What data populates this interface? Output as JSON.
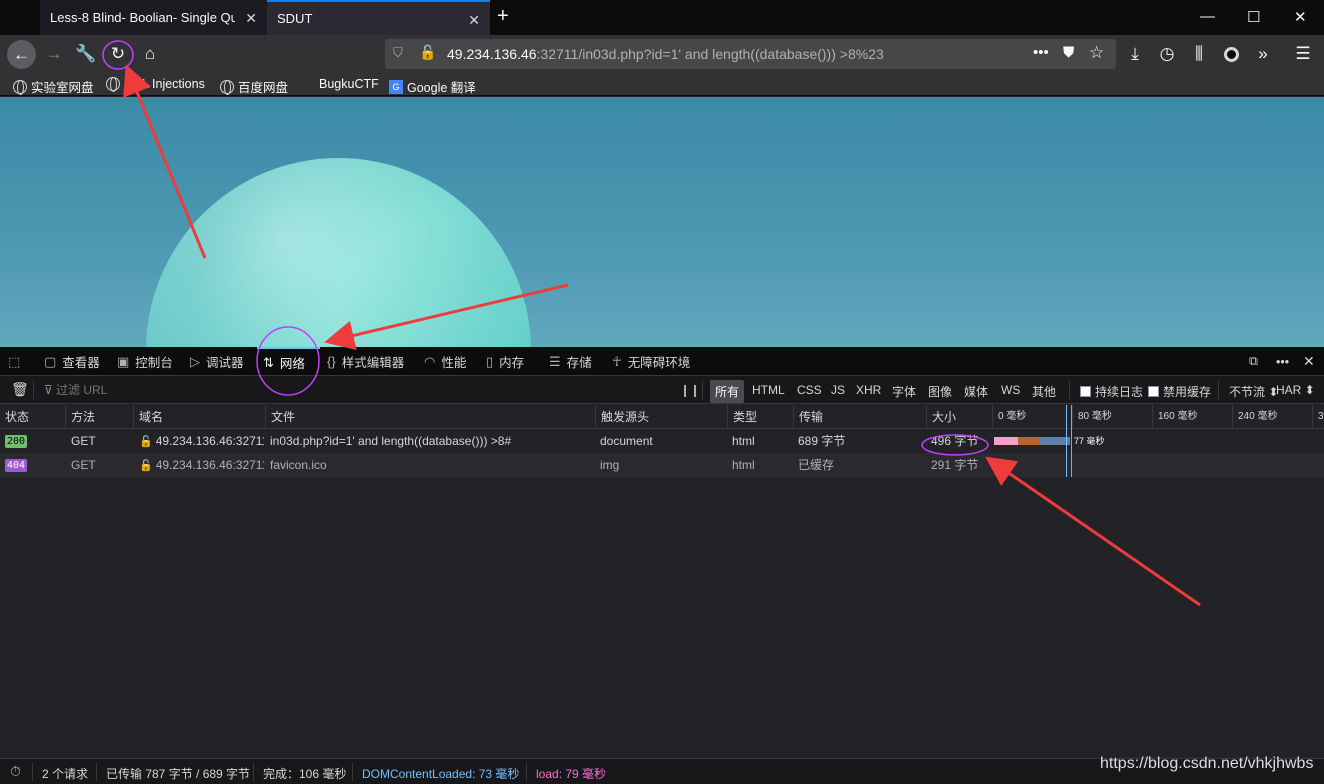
{
  "browser": {
    "tabs": [
      {
        "title": "Less-8 Blind- Boolian- Single Qu",
        "close": "✕",
        "active": false
      },
      {
        "title": "SDUT",
        "close": "✕",
        "active": true
      }
    ],
    "new_tab": "+",
    "window_controls": {
      "minimize": "—",
      "maximize": "☐",
      "close": "✕"
    },
    "url": {
      "host": "49.234.136.46",
      "rest": ":32711/in03d.php?id=1' and length((database())) >8%23"
    },
    "bookmarks": [
      "实验室网盘",
      "SQL Injections",
      "百度网盘",
      "BugkuCTF",
      "Google 翻译"
    ]
  },
  "devtools": {
    "tabs": [
      "查看器",
      "控制台",
      "调试器",
      "网络",
      "样式编辑器",
      "性能",
      "内存",
      "存储",
      "无障碍环境"
    ],
    "active_tab": "网络",
    "filter": {
      "placeholder": "过滤 URL",
      "types": [
        "所有",
        "HTML",
        "CSS",
        "JS",
        "XHR",
        "字体",
        "图像",
        "媒体",
        "WS",
        "其他"
      ],
      "active_type": "所有",
      "persist_logs": "持续日志",
      "disable_cache": "禁用缓存",
      "throttle": "不节流 ⬍",
      "har": "HAR ⬍"
    },
    "columns": [
      "状态",
      "方法",
      "域名",
      "文件",
      "触发源头",
      "类型",
      "传输",
      "大小"
    ],
    "timeline_ticks": [
      "0 毫秒",
      "80 毫秒",
      "160 毫秒",
      "240 毫秒",
      "3"
    ],
    "requests": [
      {
        "status": "200",
        "method": "GET",
        "domain": "49.234.136.46:32711",
        "file": "in03d.php?id=1' and length((database())) >8#",
        "cause": "document",
        "type": "html",
        "transferred": "689 字节",
        "size": "496 字节",
        "timing_label": "77 毫秒"
      },
      {
        "status": "404",
        "method": "GET",
        "domain": "49.234.136.46:32711",
        "file": "favicon.ico",
        "cause": "img",
        "type": "html",
        "transferred": "已缓存",
        "size": "291 字节"
      }
    ],
    "status_bar": {
      "requests": "2 个请求",
      "transferred": "已传输 787 字节 / 689 字节",
      "finish": "完成：106 毫秒",
      "dcl": "DOMContentLoaded: 73 毫秒",
      "load": "load: 79 毫秒"
    },
    "colors": {
      "status_200": "#6dc16b",
      "status_404": "#9e5bd1",
      "dcl": "#75bfff",
      "load": "#ff6bd2",
      "annotation_arrow": "#ee3b3b",
      "annotation_ellipse": "#c040ff"
    }
  },
  "watermark": "https://blog.csdn.net/vhkjhwbs"
}
